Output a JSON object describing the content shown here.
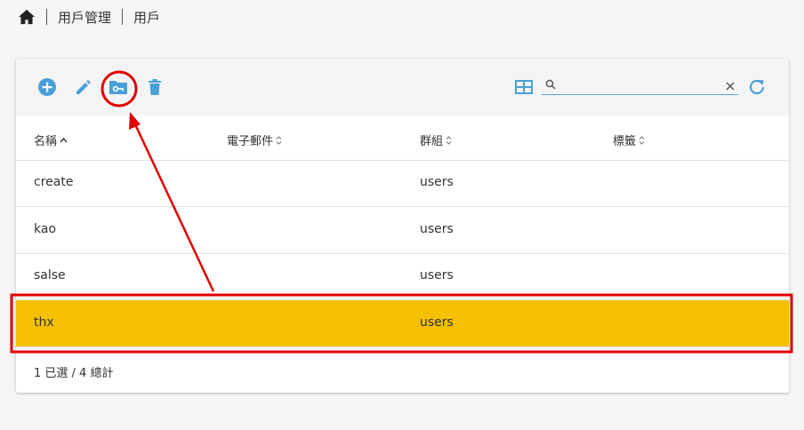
{
  "breadcrumb": {
    "items": [
      "用戶管理",
      "用戶"
    ]
  },
  "toolbar": {
    "actions": [
      "add-icon",
      "edit-icon",
      "folder-key-icon",
      "delete-icon"
    ],
    "search": {
      "value": "",
      "placeholder": ""
    }
  },
  "table": {
    "columns": [
      {
        "label": "名稱",
        "sort": "asc"
      },
      {
        "label": "電子郵件",
        "sort": "none"
      },
      {
        "label": "群組",
        "sort": "none"
      },
      {
        "label": "標籤",
        "sort": "none"
      }
    ],
    "rows": [
      {
        "name": "create",
        "email": "",
        "group": "users",
        "tags": "",
        "selected": false
      },
      {
        "name": "kao",
        "email": "",
        "group": "users",
        "tags": "",
        "selected": false
      },
      {
        "name": "salse",
        "email": "",
        "group": "users",
        "tags": "",
        "selected": false
      },
      {
        "name": "thx",
        "email": "",
        "group": "users",
        "tags": "",
        "selected": true
      }
    ]
  },
  "footer": {
    "status": "1 已選 / 4 總計"
  },
  "colors": {
    "accent": "#4a9fd8",
    "selected_row": "#f5c000",
    "annotation": "#e00000"
  }
}
